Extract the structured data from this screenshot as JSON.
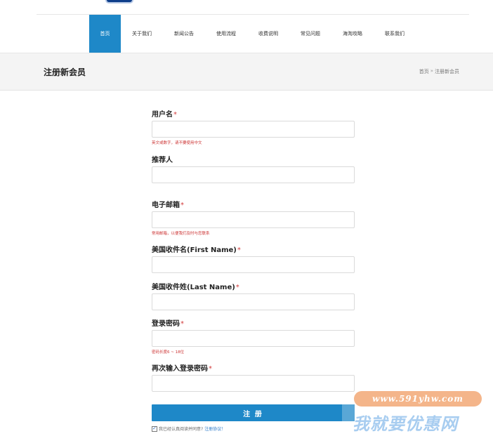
{
  "nav": {
    "items": [
      {
        "label": "首页",
        "active": true
      },
      {
        "label": "关于我们",
        "active": false
      },
      {
        "label": "新闻公告",
        "active": false
      },
      {
        "label": "使用流程",
        "active": false
      },
      {
        "label": "收费说明",
        "active": false
      },
      {
        "label": "常见问题",
        "active": false
      },
      {
        "label": "海淘攻略",
        "active": false
      },
      {
        "label": "联系我们",
        "active": false
      }
    ]
  },
  "page_header": {
    "title": "注册新会员",
    "breadcrumb": {
      "home": "首页",
      "separator": "»",
      "current": "注册新会员"
    }
  },
  "form": {
    "username": {
      "label": "用户名",
      "required": "*",
      "value": "",
      "hint": "英文或数字，请不要使用中文"
    },
    "referrer": {
      "label": "推荐人",
      "value": ""
    },
    "email": {
      "label": "电子邮箱",
      "required": "*",
      "value": "",
      "hint": "常用邮箱，以便我们及时与您联系"
    },
    "first_name": {
      "label": "美国收件名(First Name)",
      "required": "*",
      "value": ""
    },
    "last_name": {
      "label": "美国收件姓(Last Name)",
      "required": "*",
      "value": ""
    },
    "password": {
      "label": "登录密码",
      "required": "*",
      "value": "",
      "hint": "密码长度6 ~ 18位"
    },
    "password_confirm": {
      "label": "再次输入登录密码",
      "required": "*",
      "value": ""
    },
    "submit_label": "注 册",
    "agree_text": "我已经认真阅读并同意?",
    "agree_link": "注册协议！",
    "agree_checked": true
  },
  "watermark": {
    "url": "www.591yhw.com",
    "text": "我就要优惠网"
  },
  "colors": {
    "accent": "#1e88c8",
    "required": "#d23c3c",
    "link": "#2a78c8"
  }
}
